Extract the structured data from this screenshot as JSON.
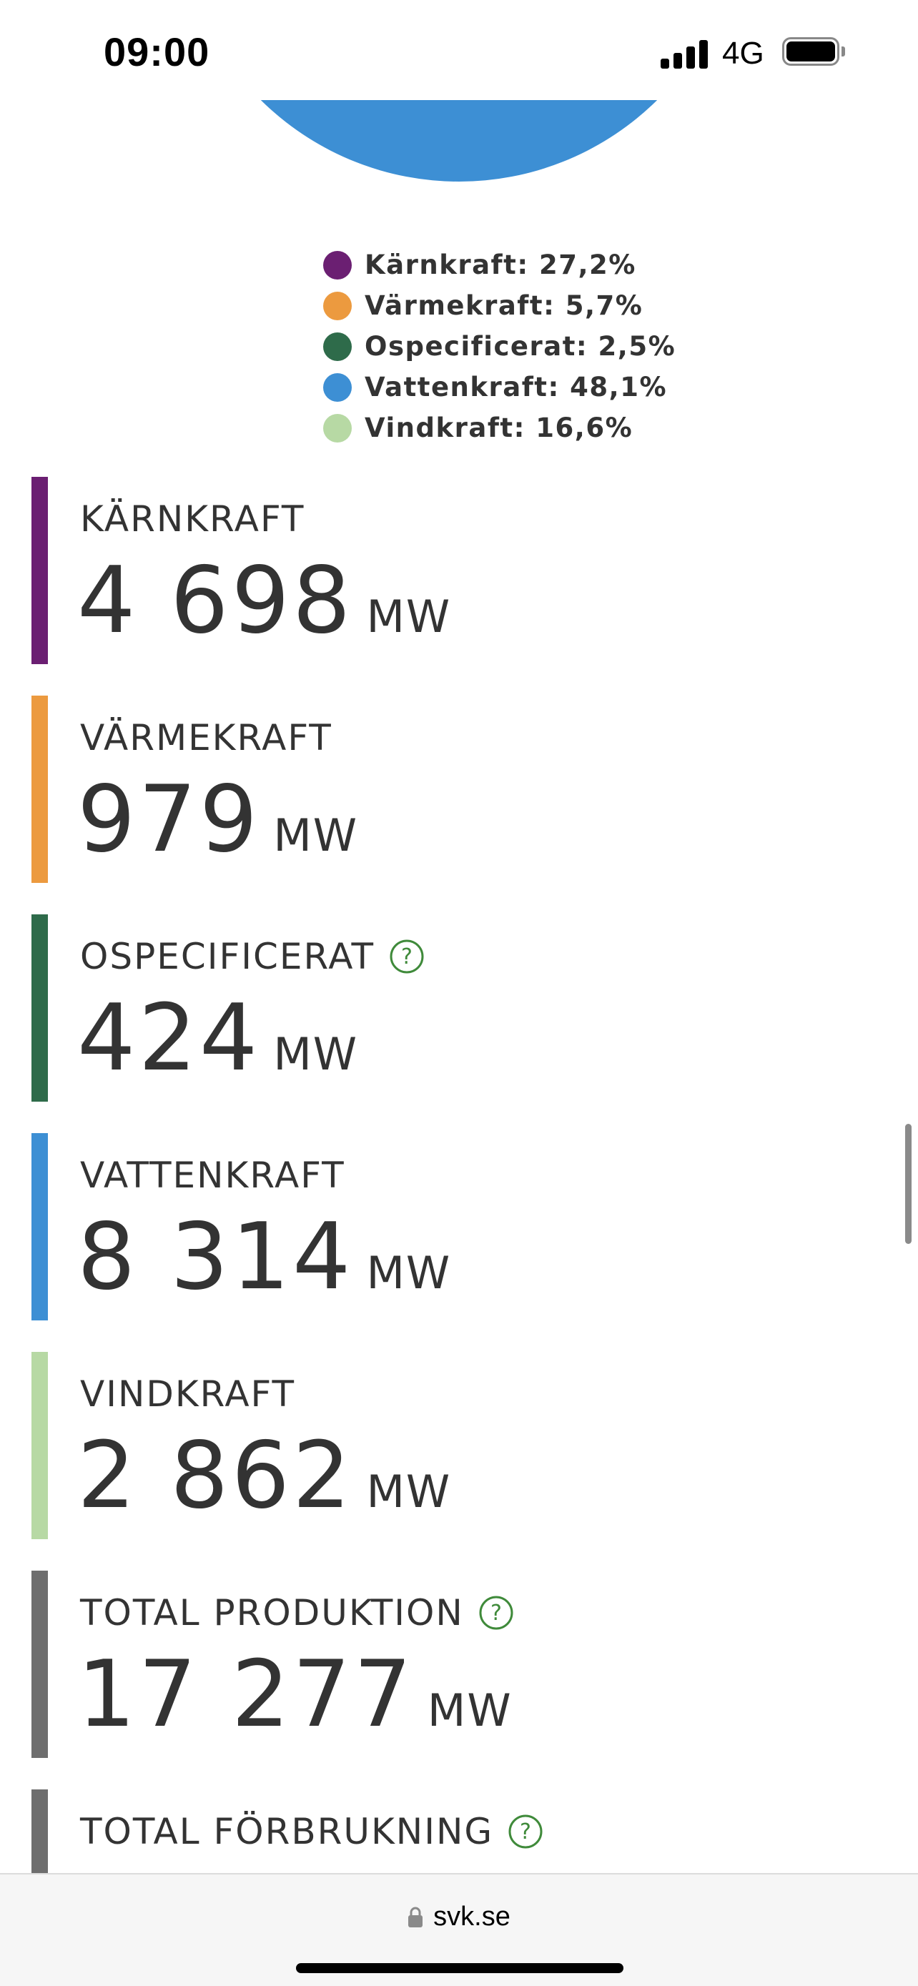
{
  "status_bar": {
    "time": "09:00",
    "network": "4G"
  },
  "chart_data": {
    "type": "pie",
    "slices": [
      {
        "name": "Kärnkraft",
        "value": 27.2,
        "color": "#6b1f72"
      },
      {
        "name": "Värmekraft",
        "value": 5.7,
        "color": "#ec9a3f"
      },
      {
        "name": "Ospecificerat",
        "value": 2.5,
        "color": "#2e6b4a"
      },
      {
        "name": "Vattenkraft",
        "value": 48.1,
        "color": "#3d8fd4"
      },
      {
        "name": "Vindkraft",
        "value": 16.6,
        "color": "#b7d9a4"
      }
    ]
  },
  "legend": [
    {
      "text": "Kärnkraft: 27,2%",
      "color": "#6b1f72"
    },
    {
      "text": "Värmekraft: 5,7%",
      "color": "#ec9a3f"
    },
    {
      "text": "Ospecificerat: 2,5%",
      "color": "#2e6b4a"
    },
    {
      "text": "Vattenkraft: 48,1%",
      "color": "#3d8fd4"
    },
    {
      "text": "Vindkraft: 16,6%",
      "color": "#b7d9a4"
    }
  ],
  "stats": [
    {
      "label": "KÄRNKRAFT",
      "value": "4 698",
      "unit": "MW",
      "color": "#6b1f72",
      "help": false
    },
    {
      "label": "VÄRMEKRAFT",
      "value": "979",
      "unit": "MW",
      "color": "#ec9a3f",
      "help": false
    },
    {
      "label": "OSPECIFICERAT",
      "value": "424",
      "unit": "MW",
      "color": "#2e6b4a",
      "help": true
    },
    {
      "label": "VATTENKRAFT",
      "value": "8 314",
      "unit": "MW",
      "color": "#3d8fd4",
      "help": false
    },
    {
      "label": "VINDKRAFT",
      "value": "2 862",
      "unit": "MW",
      "color": "#b7d9a4",
      "help": false
    },
    {
      "label": "TOTAL PRODUKTION",
      "value": "17 277",
      "unit": "MW",
      "color": "#6e6e6e",
      "help": true
    },
    {
      "label": "TOTAL FÖRBRUKNING",
      "value": "",
      "unit": "",
      "color": "#6e6e6e",
      "help": true
    }
  ],
  "browser": {
    "url": "svk.se"
  },
  "colors": {
    "help_icon": "#3f8a3a",
    "text": "#333333"
  }
}
